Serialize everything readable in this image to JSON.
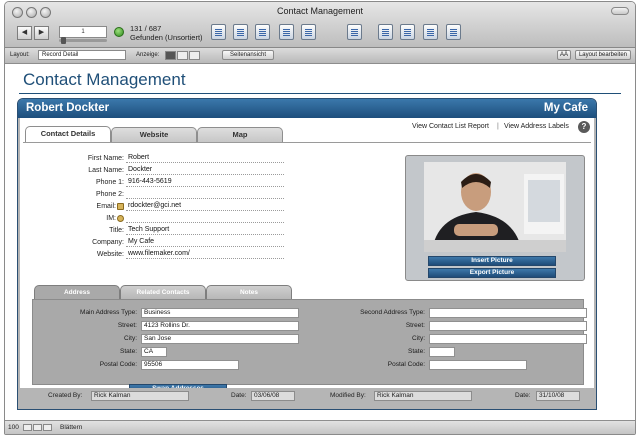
{
  "window": {
    "title": "Contact Management"
  },
  "toolbar": {
    "record_number": "1",
    "record_count": "131 / 687",
    "found_status": "Gefunden (Unsortiert)"
  },
  "layout_bar": {
    "layout_label": "Layout:",
    "layout_value": "Record Detail",
    "view_label": "Anzeige:",
    "preview_button": "Seitenansicht",
    "aa_button": "AÄ",
    "edit_layout_button": "Layout bearbeiten"
  },
  "app": {
    "title": "Contact Management"
  },
  "record": {
    "name": "Robert Dockter",
    "company": "My Cafe"
  },
  "tabs": [
    {
      "label": "Contact Details"
    },
    {
      "label": "Website"
    },
    {
      "label": "Map"
    }
  ],
  "links": {
    "view_contact_list": "View Contact List Report",
    "separator": "|",
    "view_address_labels": "View Address Labels",
    "help": "?"
  },
  "contact": {
    "first_name_label": "First Name:",
    "first_name": "Robert",
    "last_name_label": "Last Name:",
    "last_name": "Dockter",
    "phone1_label": "Phone 1:",
    "phone1": "916-443-5619",
    "phone2_label": "Phone 2:",
    "phone2": "",
    "email_label": "Email:",
    "email": "rdockter@gci.net",
    "im_label": "IM:",
    "im": "",
    "title_label": "Title:",
    "title": "Tech Support",
    "company_label": "Company:",
    "company": "My Cafe",
    "website_label": "Website:",
    "website": "www.filemaker.com/"
  },
  "photo": {
    "insert_button": "Insert Picture",
    "export_button": "Export Picture"
  },
  "address_tabs": [
    {
      "label": "Address"
    },
    {
      "label": "Related Contacts"
    },
    {
      "label": "Notes"
    }
  ],
  "address": {
    "main_type_label": "Main Address Type:",
    "main_type": "Business",
    "street_label": "Street:",
    "street": "4123 Rollins Dr.",
    "city_label": "City:",
    "city": "San Jose",
    "state_label": "State:",
    "state": "CA",
    "postal_label": "Postal Code:",
    "postal": "95506",
    "swap_button": "Swap Addresses",
    "second_type_label": "Second Address Type:",
    "second_type": "",
    "street2_label": "Street:",
    "street2": "",
    "city2_label": "City:",
    "city2": "",
    "state2_label": "State:",
    "state2": "",
    "postal2_label": "Postal Code:",
    "postal2": ""
  },
  "footer": {
    "created_by_label": "Created By:",
    "created_by": "Rick Kalman",
    "date_label": "Date:",
    "created_date": "03/06/08",
    "modified_by_label": "Modified By:",
    "modified_by": "Rick Kalman",
    "date2_label": "Date:",
    "modified_date": "31/10/08"
  },
  "statusbar": {
    "zoom": "100",
    "mode": "Blättern"
  },
  "colors": {
    "accent": "#1f4f78",
    "header_gradient_top": "#3b78ab",
    "button_blue": "#1f4c79"
  }
}
